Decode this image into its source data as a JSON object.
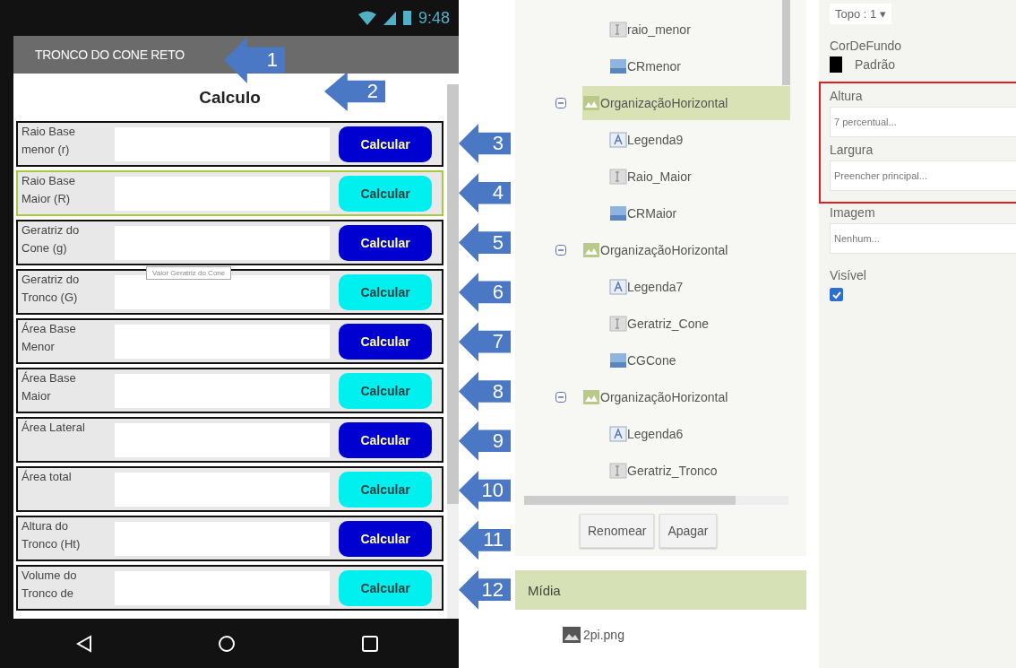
{
  "phone": {
    "status_time": "9:48",
    "title": "TRONCO DO CONE RETO",
    "title_callout": "1",
    "heading": "Calculo",
    "heading_callout": "2",
    "rows": [
      {
        "label": "Raio Base menor (r)",
        "button": "Calcular",
        "kind": "dark",
        "selected": false,
        "callout": "3"
      },
      {
        "label": "Raio Base Maior (R)",
        "button": "Calcular",
        "kind": "light",
        "selected": true,
        "callout": "4"
      },
      {
        "label": "Geratriz do Cone (g)",
        "button": "Calcular",
        "kind": "dark",
        "selected": false,
        "callout": "5"
      },
      {
        "label": "Geratriz do Tronco (G)",
        "button": "Calcular",
        "kind": "light",
        "selected": false,
        "callout": "6"
      },
      {
        "label": "Área Base Menor",
        "button": "Calcular",
        "kind": "dark",
        "selected": false,
        "callout": "7"
      },
      {
        "label": "Área Base Maior",
        "button": "Calcular",
        "kind": "light",
        "selected": false,
        "callout": "8"
      },
      {
        "label": "Área Lateral",
        "button": "Calcular",
        "kind": "dark",
        "selected": false,
        "callout": "9"
      },
      {
        "label": "Área total",
        "button": "Calcular",
        "kind": "light",
        "selected": false,
        "callout": "10"
      },
      {
        "label": "Altura do Tronco (Ht)",
        "button": "Calcular",
        "kind": "dark",
        "selected": false,
        "callout": "11"
      },
      {
        "label": "Volume do Tronco de",
        "button": "Calcular",
        "kind": "light",
        "selected": false,
        "callout": "12"
      }
    ],
    "tooltip": "Valor Geratriz  do Cone"
  },
  "components": {
    "orphans": [
      {
        "name": "raio_menor",
        "kind": "textbox"
      },
      {
        "name": "CRmenor",
        "kind": "button"
      }
    ],
    "nodes": [
      {
        "name": "OrganizaçãoHorizontal",
        "kind": "arrangement",
        "selected": true,
        "expanded": true,
        "children": [
          {
            "name": "Legenda9",
            "kind": "label"
          },
          {
            "name": "Raio_Maior",
            "kind": "textbox"
          },
          {
            "name": "CRMaior",
            "kind": "button"
          }
        ]
      },
      {
        "name": "OrganizaçãoHorizontal",
        "kind": "arrangement",
        "selected": false,
        "expanded": true,
        "children": [
          {
            "name": "Legenda7",
            "kind": "label"
          },
          {
            "name": "Geratriz_Cone",
            "kind": "textbox"
          },
          {
            "name": "CGCone",
            "kind": "button"
          }
        ]
      },
      {
        "name": "OrganizaçãoHorizontal",
        "kind": "arrangement",
        "selected": false,
        "expanded": true,
        "children": [
          {
            "name": "Legenda6",
            "kind": "label"
          },
          {
            "name": "Geratriz_Tronco",
            "kind": "textbox"
          }
        ]
      }
    ],
    "buttons": [
      "Renomear",
      "Apagar"
    ]
  },
  "media": {
    "title": "Mídia",
    "items": [
      "2pi.png"
    ]
  },
  "properties": {
    "position": "Topo : 1 ▾",
    "background_label": "CorDeFundo",
    "background_value": "Padrão",
    "highlighted": [
      {
        "label": "Altura",
        "value": "7 percentual..."
      },
      {
        "label": "Largura",
        "value": "Preencher principal..."
      }
    ],
    "image_label": "Imagem",
    "image_value": "Nenhum...",
    "visible_label": "Visível",
    "visible": true
  }
}
